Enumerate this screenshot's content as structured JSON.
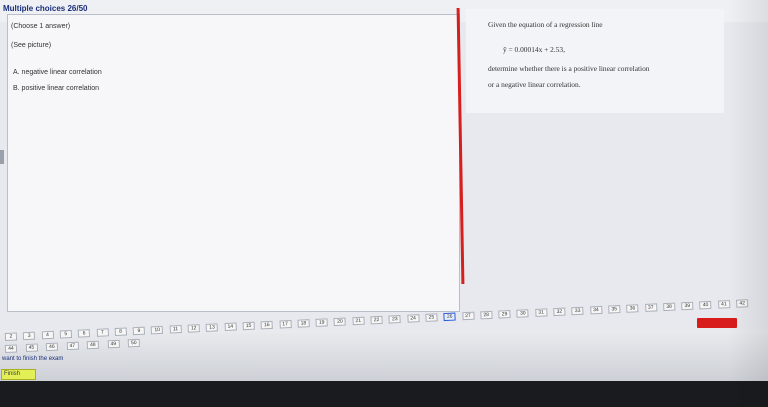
{
  "header": {
    "title": "Multiple choices 26/50"
  },
  "question_left": {
    "instruction": "(Choose 1 answer)",
    "see_picture": "(See picture)",
    "options": [
      "A.  negative linear correlation",
      "B.  positive linear correlation"
    ]
  },
  "question_right": {
    "line1": "Given the equation of a regression line",
    "equation": "ŷ = 0.00014x + 2.53,",
    "line2": "determine whether there is a positive linear correlation",
    "line3": "or a negative linear correlation."
  },
  "navigation": {
    "row1": [
      "2",
      "3",
      "4",
      "5",
      "6",
      "7",
      "8",
      "9",
      "10",
      "11",
      "12",
      "13",
      "14",
      "15",
      "16",
      "17",
      "18",
      "19",
      "20",
      "21",
      "22",
      "23",
      "24",
      "25",
      "26",
      "27",
      "28",
      "29",
      "30",
      "31",
      "32",
      "33",
      "34",
      "35",
      "36",
      "37",
      "38",
      "39",
      "40",
      "41",
      "42"
    ],
    "row2": [
      "44",
      "45",
      "46",
      "47",
      "48",
      "49",
      "50"
    ],
    "current": "26"
  },
  "footer": {
    "finish_prompt": "want to finish the exam",
    "finish_label": "Finish"
  },
  "colors": {
    "title": "#1a2f7a",
    "divider": "#d62020",
    "finish": "#e3ef56",
    "redbutton": "#d81c1c"
  }
}
